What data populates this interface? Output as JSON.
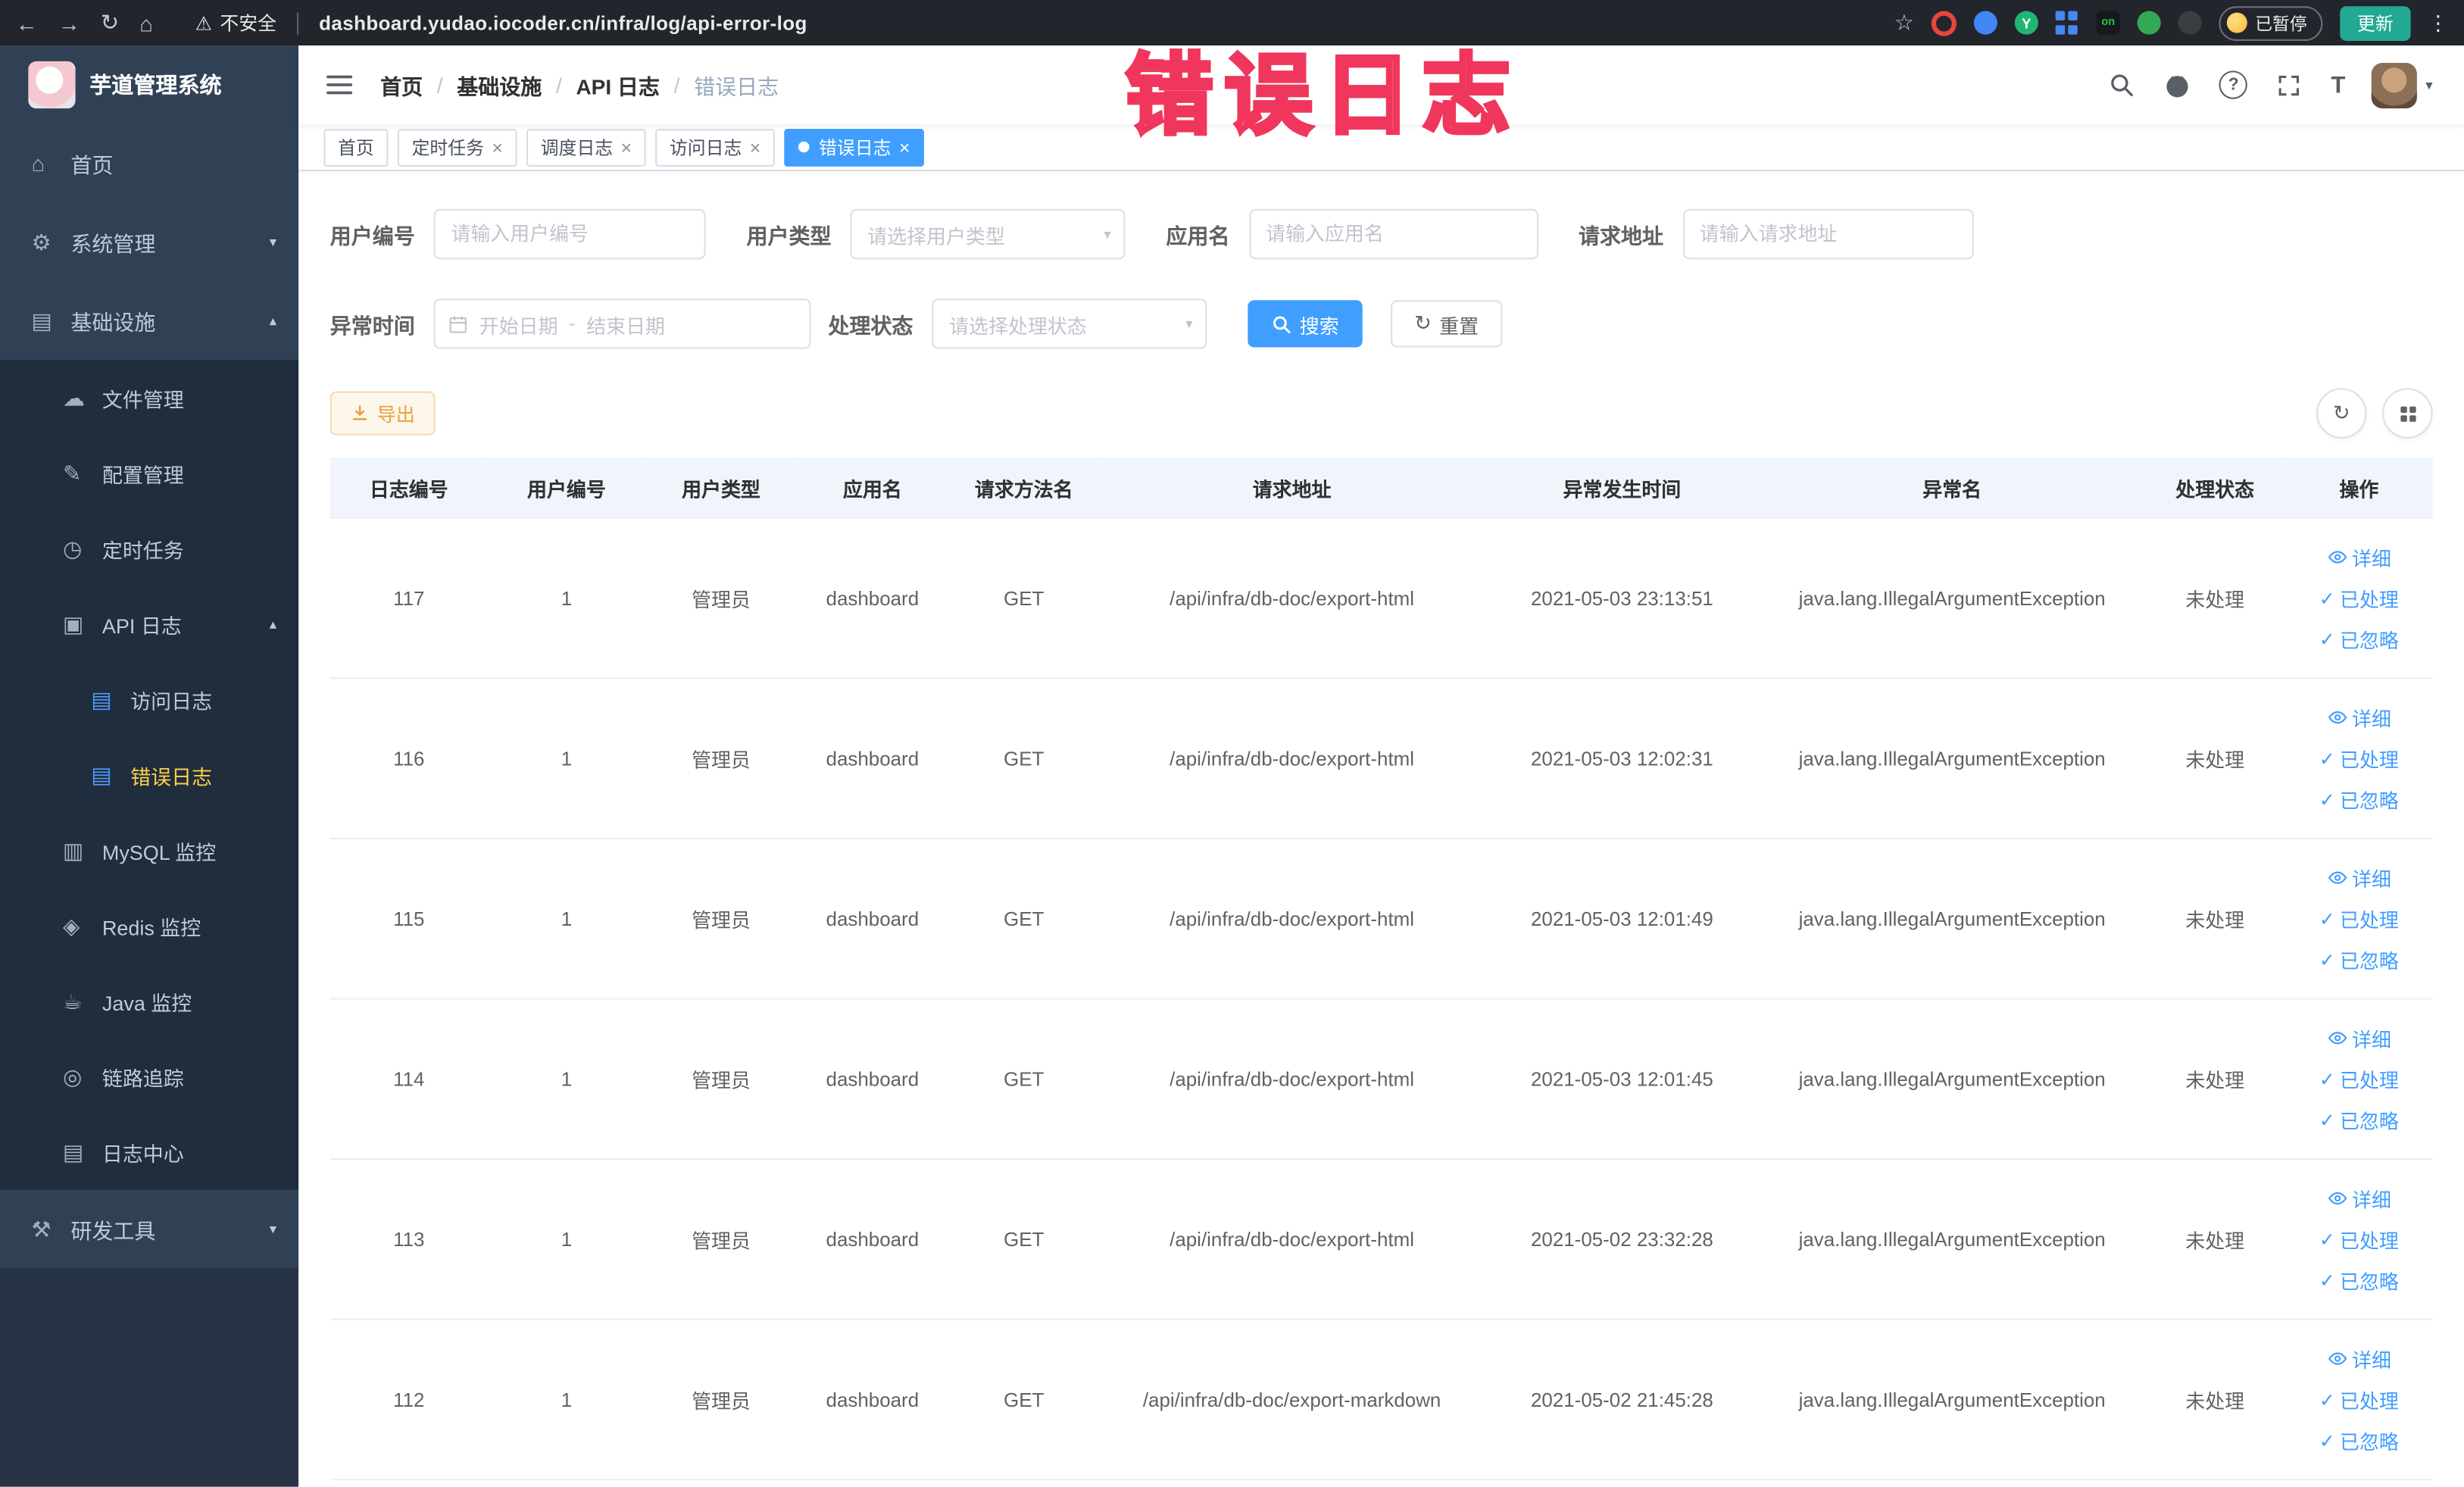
{
  "browser": {
    "security_warning": "不安全",
    "url": "dashboard.yudao.iocoder.cn/infra/log/api-error-log",
    "ext_on": "on",
    "ext_y": "Y",
    "paused_badge": "已暂停",
    "update_button": "更新"
  },
  "watermark": {
    "text": "错误日志"
  },
  "icons": {
    "back": "←",
    "forward": "→",
    "reload": "↻",
    "home_nav": "⌂",
    "warning": "⚠",
    "star": "☆",
    "more": "⋮",
    "close": "×",
    "caret": "▾",
    "question": "?",
    "fontsize": "T",
    "chevron_down": "▾",
    "chevron_up": "▴",
    "check": "✓",
    "refresh": "↻",
    "home": "⌂",
    "gear": "⚙",
    "infra": "▤",
    "cloud": "☁",
    "edit": "✎",
    "clock": "◷",
    "apilog": "▣",
    "doc": "▤",
    "db": "▥",
    "redis": "◈",
    "java": "☕",
    "trace": "◎",
    "logcenter": "▤",
    "tools": "⚒"
  },
  "colors": {
    "primary": "#409eff",
    "sidebar_bg": "#304156",
    "submenu_bg": "#1f2d3d",
    "active_menu_text": "#ffd04b",
    "warning_button": "#e6a23c",
    "tab_active_bg": "#409eff",
    "watermark_pink": "#f0365c"
  },
  "sidebar": {
    "title": "芋道管理系统",
    "items": [
      {
        "label": "首页"
      },
      {
        "label": "系统管理"
      },
      {
        "label": "基础设施"
      },
      {
        "label": "文件管理"
      },
      {
        "label": "配置管理"
      },
      {
        "label": "定时任务"
      },
      {
        "label": "API 日志"
      },
      {
        "label": "访问日志"
      },
      {
        "label": "错误日志"
      },
      {
        "label": "MySQL 监控"
      },
      {
        "label": "Redis 监控"
      },
      {
        "label": "Java 监控"
      },
      {
        "label": "链路追踪"
      },
      {
        "label": "日志中心"
      },
      {
        "label": "研发工具"
      }
    ]
  },
  "header": {
    "breadcrumb": [
      "首页",
      "基础设施",
      "API 日志",
      "错误日志"
    ],
    "breadcrumb_separator": "/"
  },
  "tabs": [
    {
      "label": "首页"
    },
    {
      "label": "定时任务"
    },
    {
      "label": "调度日志"
    },
    {
      "label": "访问日志"
    },
    {
      "label": "错误日志"
    }
  ],
  "filters": {
    "user_id": {
      "label": "用户编号",
      "placeholder": "请输入用户编号"
    },
    "user_type": {
      "label": "用户类型",
      "placeholder": "请选择用户类型"
    },
    "app_name": {
      "label": "应用名",
      "placeholder": "请输入应用名"
    },
    "request_url": {
      "label": "请求地址",
      "placeholder": "请输入请求地址"
    },
    "exception_time": {
      "label": "异常时间",
      "start_placeholder": "开始日期",
      "end_placeholder": "结束日期",
      "separator": "-"
    },
    "process_status": {
      "label": "处理状态",
      "placeholder": "请选择处理状态"
    },
    "search_button": "搜索",
    "reset_button": "重置"
  },
  "toolbar": {
    "export_button": "导出"
  },
  "table": {
    "columns": [
      "日志编号",
      "用户编号",
      "用户类型",
      "应用名",
      "请求方法名",
      "请求地址",
      "异常发生时间",
      "异常名",
      "处理状态",
      "操作"
    ],
    "actions": [
      "详细",
      "已处理",
      "已忽略"
    ],
    "rows": [
      {
        "id": "117",
        "user_id": "1",
        "user_type": "管理员",
        "app": "dashboard",
        "method": "GET",
        "url": "/api/infra/db-doc/export-html",
        "time": "2021-05-03 23:13:51",
        "exception": "java.lang.IllegalArgumentException",
        "status": "未处理"
      },
      {
        "id": "116",
        "user_id": "1",
        "user_type": "管理员",
        "app": "dashboard",
        "method": "GET",
        "url": "/api/infra/db-doc/export-html",
        "time": "2021-05-03 12:02:31",
        "exception": "java.lang.IllegalArgumentException",
        "status": "未处理"
      },
      {
        "id": "115",
        "user_id": "1",
        "user_type": "管理员",
        "app": "dashboard",
        "method": "GET",
        "url": "/api/infra/db-doc/export-html",
        "time": "2021-05-03 12:01:49",
        "exception": "java.lang.IllegalArgumentException",
        "status": "未处理"
      },
      {
        "id": "114",
        "user_id": "1",
        "user_type": "管理员",
        "app": "dashboard",
        "method": "GET",
        "url": "/api/infra/db-doc/export-html",
        "time": "2021-05-03 12:01:45",
        "exception": "java.lang.IllegalArgumentException",
        "status": "未处理"
      },
      {
        "id": "113",
        "user_id": "1",
        "user_type": "管理员",
        "app": "dashboard",
        "method": "GET",
        "url": "/api/infra/db-doc/export-html",
        "time": "2021-05-02 23:32:28",
        "exception": "java.lang.IllegalArgumentException",
        "status": "未处理"
      },
      {
        "id": "112",
        "user_id": "1",
        "user_type": "管理员",
        "app": "dashboard",
        "method": "GET",
        "url": "/api/infra/db-doc/export-markdown",
        "time": "2021-05-02 21:45:28",
        "exception": "java.lang.IllegalArgumentException",
        "status": "未处理"
      }
    ]
  }
}
